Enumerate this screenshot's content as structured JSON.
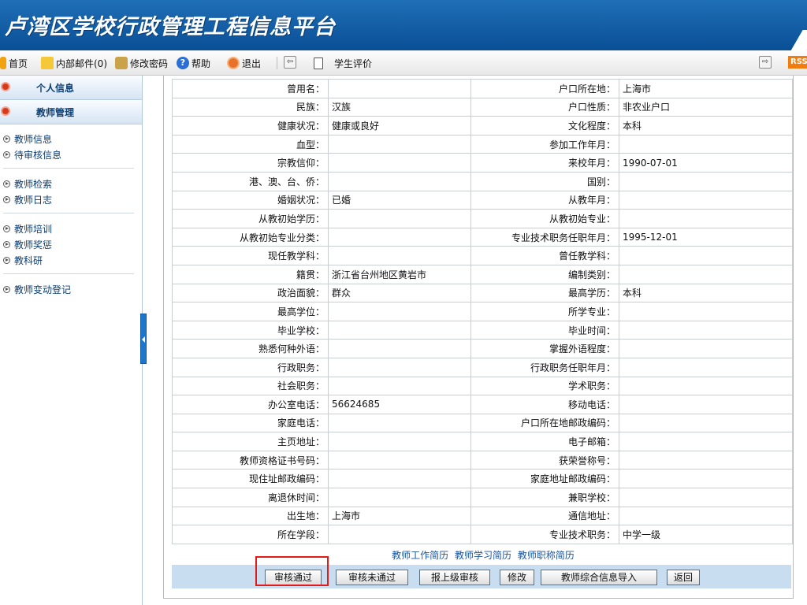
{
  "app": {
    "title": "卢湾区学校行政管理工程信息平台"
  },
  "toolbar": {
    "home": "首页",
    "mail": "内部邮件(0)",
    "password": "修改密码",
    "help": "帮助",
    "logout": "退出",
    "student_eval": "学生评价",
    "rss": "RSS"
  },
  "sidebar": {
    "personal": "个人信息",
    "teacher_mgmt": "教师管理",
    "items": [
      "教师信息",
      "待审核信息",
      "教师检索",
      "教师日志",
      "教师培训",
      "教师奖惩",
      "教科研",
      "教师变动登记"
    ]
  },
  "rows": [
    {
      "l1": "曾用名：",
      "v1": "",
      "l2": "户口所在地：",
      "v2": "上海市"
    },
    {
      "l1": "民族：",
      "v1": "汉族",
      "l2": "户口性质：",
      "v2": "非农业户口"
    },
    {
      "l1": "健康状况：",
      "v1": "健康或良好",
      "l2": "文化程度：",
      "v2": "本科"
    },
    {
      "l1": "血型：",
      "v1": "",
      "l2": "参加工作年月：",
      "v2": ""
    },
    {
      "l1": "宗教信仰：",
      "v1": "",
      "l2": "来校年月：",
      "v2": "1990-07-01"
    },
    {
      "l1": "港、澳、台、侨：",
      "v1": "",
      "l2": "国别：",
      "v2": ""
    },
    {
      "l1": "婚姻状况：",
      "v1": "已婚",
      "l2": "从教年月：",
      "v2": ""
    },
    {
      "l1": "从教初始学历：",
      "v1": "",
      "l2": "从教初始专业：",
      "v2": ""
    },
    {
      "l1": "从教初始专业分类：",
      "v1": "",
      "l2": "专业技术职务任职年月：",
      "v2": "1995-12-01"
    },
    {
      "l1": "现任教学科：",
      "v1": "",
      "l2": "曾任教学科：",
      "v2": ""
    },
    {
      "l1": "籍贯：",
      "v1": "浙江省台州地区黄岩市",
      "l2": "编制类别：",
      "v2": ""
    },
    {
      "l1": "政治面貌：",
      "v1": "群众",
      "l2": "最高学历：",
      "v2": "本科"
    },
    {
      "l1": "最高学位：",
      "v1": "",
      "l2": "所学专业：",
      "v2": ""
    },
    {
      "l1": "毕业学校：",
      "v1": "",
      "l2": "毕业时间：",
      "v2": ""
    },
    {
      "l1": "熟悉何种外语：",
      "v1": "",
      "l2": "掌握外语程度：",
      "v2": ""
    },
    {
      "l1": "行政职务：",
      "v1": "",
      "l2": "行政职务任职年月：",
      "v2": ""
    },
    {
      "l1": "社会职务：",
      "v1": "",
      "l2": "学术职务：",
      "v2": ""
    },
    {
      "l1": "办公室电话：",
      "v1": "56624685",
      "l2": "移动电话：",
      "v2": ""
    },
    {
      "l1": "家庭电话：",
      "v1": "",
      "l2": "户口所在地邮政编码：",
      "v2": ""
    },
    {
      "l1": "主页地址：",
      "v1": "",
      "l2": "电子邮箱：",
      "v2": ""
    },
    {
      "l1": "教师资格证书号码：",
      "v1": "",
      "l2": "获荣誉称号：",
      "v2": ""
    },
    {
      "l1": "现住址邮政编码：",
      "v1": "",
      "l2": "家庭地址邮政编码：",
      "v2": ""
    },
    {
      "l1": "离退休时间：",
      "v1": "",
      "l2": "兼职学校：",
      "v2": ""
    },
    {
      "l1": "出生地：",
      "v1": "上海市",
      "l2": "通信地址：",
      "v2": ""
    },
    {
      "l1": "所在学段：",
      "v1": "",
      "l2": "专业技术职务：",
      "v2": "中学一级"
    }
  ],
  "links": {
    "work": "教师工作简历",
    "study": "教师学习简历",
    "title": "教师职称简历"
  },
  "buttons": {
    "approve": "审核通过",
    "reject": "审核未通过",
    "upper": "报上级审核",
    "edit": "修改",
    "import": "教师综合信息导入",
    "back": "返回"
  },
  "colors": {
    "header": "#0a4f96",
    "sidebar_text": "#0b3d73",
    "link": "#1a56a0",
    "button_bar": "#c8def0",
    "highlight": "#e11a1a"
  }
}
